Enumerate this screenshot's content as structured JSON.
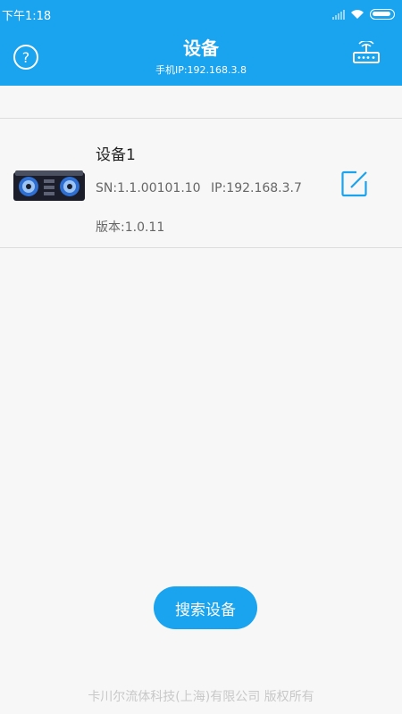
{
  "status_bar": {
    "time": "下午1:18",
    "icons": [
      "signal-icon",
      "wifi-icon",
      "battery-icon"
    ]
  },
  "header": {
    "title": "设备",
    "phone_ip": "手机IP:192.168.3.8",
    "help_label": "?",
    "color": "#1aa3ee"
  },
  "devices": [
    {
      "name": "设备1",
      "sn": "SN:1.1.00101.10",
      "ip": "IP:192.168.3.7",
      "version": "版本:1.0.11"
    }
  ],
  "search_button": {
    "label": "搜索设备"
  },
  "footer": {
    "copyright": "卡川尔流体科技(上海)有限公司 版权所有"
  }
}
